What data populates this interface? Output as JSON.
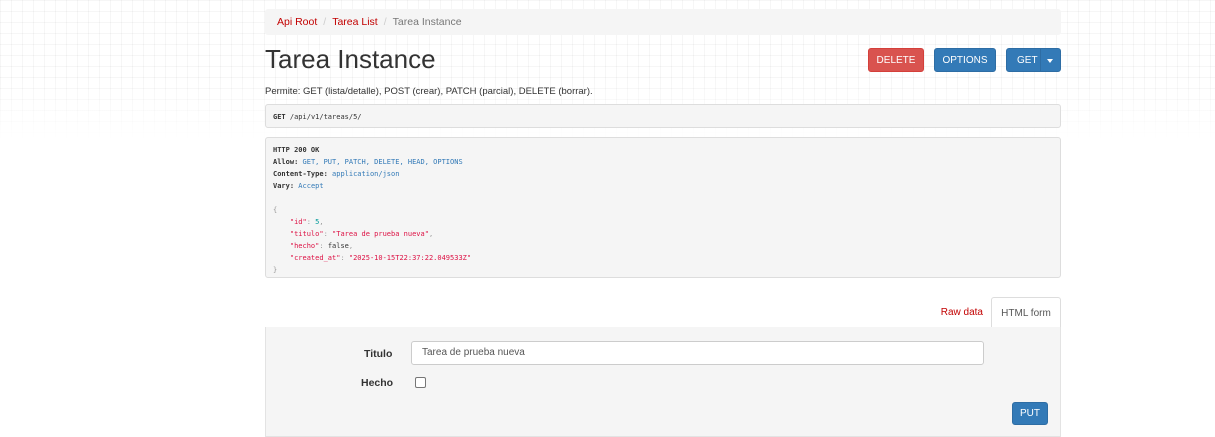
{
  "breadcrumb": {
    "items": [
      "Api Root",
      "Tarea List"
    ],
    "active": "Tarea Instance",
    "separator": "/"
  },
  "page": {
    "title": "Tarea Instance",
    "description": "Permite: GET (lista/detalle), POST (crear), PATCH (parcial), DELETE (borrar)."
  },
  "actions": {
    "delete_label": "DELETE",
    "options_label": "OPTIONS",
    "get_label": "GET"
  },
  "request": {
    "method": "GET",
    "path": "/api/v1/tareas/5/"
  },
  "response": {
    "status": "HTTP 200 OK",
    "headers": [
      {
        "name": "Allow:",
        "value": "GET, PUT, PATCH, DELETE, HEAD, OPTIONS"
      },
      {
        "name": "Content-Type:",
        "value": "application/json"
      },
      {
        "name": "Vary:",
        "value": "Accept"
      }
    ],
    "open_brace": "{",
    "close_brace": "}",
    "body": [
      {
        "key": "\"id\"",
        "value": "5",
        "type": "num",
        "comma": ","
      },
      {
        "key": "\"titulo\"",
        "value": "\"Tarea de prueba nueva\"",
        "type": "str",
        "comma": ","
      },
      {
        "key": "\"hecho\"",
        "value": "false",
        "type": "bool",
        "comma": ","
      },
      {
        "key": "\"created_at\"",
        "value": "\"2025-10-15T22:37:22.049533Z\"",
        "type": "str",
        "comma": ""
      }
    ]
  },
  "tabs": {
    "raw_label": "Raw data",
    "html_label": "HTML form"
  },
  "form": {
    "titulo_label": "Titulo",
    "titulo_value": "Tarea de prueba nueva",
    "hecho_label": "Hecho",
    "hecho_checked": false,
    "submit_label": "PUT"
  },
  "colors": {
    "link": "#c20000",
    "primary": "#337ab7",
    "danger": "#d9534f"
  }
}
